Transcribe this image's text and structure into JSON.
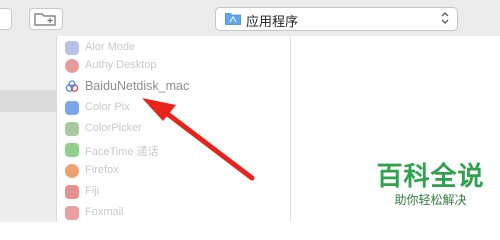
{
  "toolbar": {
    "location_label": "应用程序",
    "new_folder_icon": "folder-plus-icon",
    "folder_icon": "folder-icon",
    "stepper_icon": "up-down-chevron-icon"
  },
  "files": [
    {
      "name": "Alor Mode",
      "icon_color": "#b7c3e6"
    },
    {
      "name": "Authy Desktop",
      "icon_color": "#e89a9a"
    },
    {
      "name": "BaiduNetdisk_mac",
      "icon_color": "#6aa8ff"
    },
    {
      "name": "Color Pix",
      "icon_color": "#7aa6e8"
    },
    {
      "name": "ColorPicker",
      "icon_color": "#a8c8a0"
    },
    {
      "name": "FaceTime 通话",
      "icon_color": "#8fd08f"
    },
    {
      "name": "Firefox",
      "icon_color": "#f0a070"
    },
    {
      "name": "Fiji",
      "icon_color": "#e89090"
    },
    {
      "name": "Foxmail",
      "icon_color": "#e8a0a0"
    }
  ],
  "watermark": {
    "title": "百科全说",
    "subtitle": "助你轻松解决"
  },
  "colors": {
    "arrow": "#e8231b",
    "watermark_green": "#2ea24f"
  }
}
